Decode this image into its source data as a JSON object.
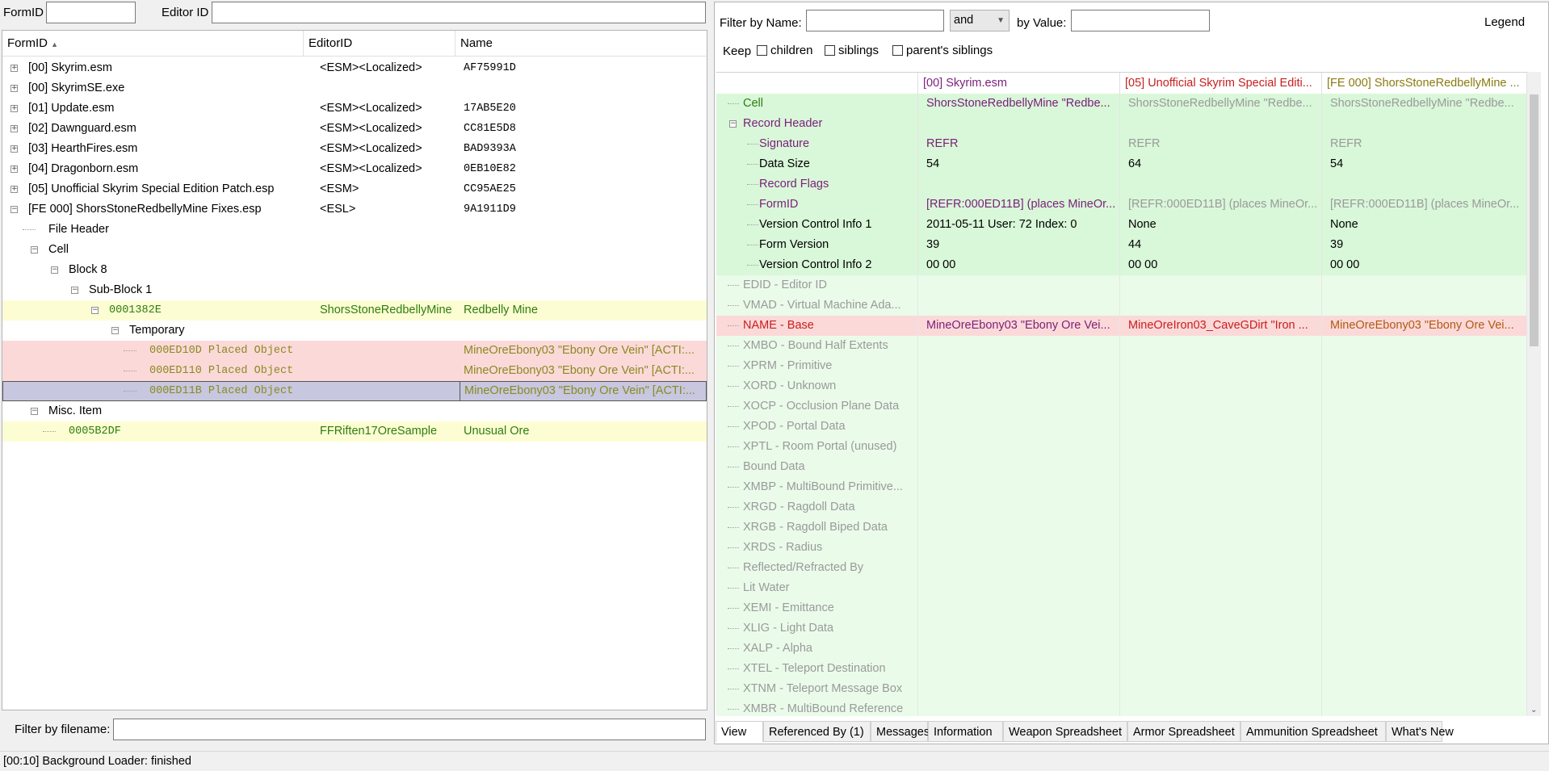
{
  "top": {
    "formid_label": "FormID",
    "editorid_label": "Editor ID",
    "formid_value": "",
    "editorid_value": ""
  },
  "tree": {
    "headers": [
      "FormID",
      "EditorID",
      "Name"
    ],
    "rows": [
      {
        "form": "[00] Skyrim.esm",
        "editor": "<ESM><Localized>",
        "name": "AF75991D"
      },
      {
        "form": "[00] SkyrimSE.exe",
        "editor": "",
        "name": ""
      },
      {
        "form": "[01] Update.esm",
        "editor": "<ESM><Localized>",
        "name": "17AB5E20"
      },
      {
        "form": "[02] Dawnguard.esm",
        "editor": "<ESM><Localized>",
        "name": "CC81E5D8"
      },
      {
        "form": "[03] HearthFires.esm",
        "editor": "<ESM><Localized>",
        "name": "BAD9393A"
      },
      {
        "form": "[04] Dragonborn.esm",
        "editor": "<ESM><Localized>",
        "name": "0EB10E82"
      },
      {
        "form": "[05] Unofficial Skyrim Special Edition Patch.esp",
        "editor": "<ESM>",
        "name": "CC95AE25"
      },
      {
        "form": "[FE 000] ShorsStoneRedbellyMine Fixes.esp",
        "editor": "<ESL>",
        "name": "9A1911D9"
      },
      {
        "form": "File Header",
        "editor": "",
        "name": ""
      },
      {
        "form": "Cell",
        "editor": "",
        "name": ""
      },
      {
        "form": "Block 8",
        "editor": "",
        "name": ""
      },
      {
        "form": "Sub-Block 1",
        "editor": "",
        "name": ""
      },
      {
        "form": "0001382E",
        "editor": "ShorsStoneRedbellyMine",
        "name": "Redbelly Mine"
      },
      {
        "form": "Temporary",
        "editor": "",
        "name": ""
      },
      {
        "form": "000ED10D  Placed Object",
        "editor": "",
        "name": "MineOreEbony03 \"Ebony Ore Vein\" [ACTI:..."
      },
      {
        "form": "000ED110  Placed Object",
        "editor": "",
        "name": "MineOreEbony03 \"Ebony Ore Vein\" [ACTI:..."
      },
      {
        "form": "000ED11B  Placed Object",
        "editor": "",
        "name": "MineOreEbony03 \"Ebony Ore Vein\" [ACTI:..."
      },
      {
        "form": "Misc. Item",
        "editor": "",
        "name": ""
      },
      {
        "form": "0005B2DF",
        "editor": "FFRiften17OreSample",
        "name": "Unusual Ore"
      }
    ]
  },
  "bottom_filter": {
    "label": "Filter by filename:",
    "value": ""
  },
  "right": {
    "filter_name_label": "Filter by Name:",
    "filter_name_value": "",
    "and_option": "and",
    "by_value_label": "by Value:",
    "by_value_value": "",
    "legend": "Legend",
    "keep_label": "Keep",
    "keep_children": "children",
    "keep_siblings": "siblings",
    "keep_parents": "parent's siblings"
  },
  "grid": {
    "headers": [
      "[00] Skyrim.esm",
      "[05] Unofficial Skyrim Special Editi...",
      "[FE 000] ShorsStoneRedbellyMine ..."
    ],
    "rows": [
      {
        "label": "Cell",
        "v": [
          "ShorsStoneRedbellyMine \"Redbe...",
          "ShorsStoneRedbellyMine \"Redbe...",
          "ShorsStoneRedbellyMine \"Redbe..."
        ]
      },
      {
        "label": "Record Header",
        "v": [
          "",
          "",
          ""
        ]
      },
      {
        "label": "Signature",
        "v": [
          "REFR",
          "REFR",
          "REFR"
        ]
      },
      {
        "label": "Data Size",
        "v": [
          "54",
          "64",
          "54"
        ]
      },
      {
        "label": "Record Flags",
        "v": [
          "",
          "",
          ""
        ]
      },
      {
        "label": "FormID",
        "v": [
          "[REFR:000ED11B] (places MineOr...",
          "[REFR:000ED11B] (places MineOr...",
          "[REFR:000ED11B] (places MineOr..."
        ]
      },
      {
        "label": "Version Control Info 1",
        "v": [
          "2011-05-11 User: 72 Index: 0",
          "None",
          "None"
        ]
      },
      {
        "label": "Form Version",
        "v": [
          "39",
          "44",
          "39"
        ]
      },
      {
        "label": "Version Control Info 2",
        "v": [
          "00 00",
          "00 00",
          "00 00"
        ]
      },
      {
        "label": "EDID - Editor ID",
        "v": [
          "",
          "",
          ""
        ]
      },
      {
        "label": "VMAD - Virtual Machine Ada...",
        "v": [
          "",
          "",
          ""
        ]
      },
      {
        "label": "NAME - Base",
        "v": [
          "MineOreEbony03 \"Ebony Ore Vei...",
          "MineOreIron03_CaveGDirt \"Iron ...",
          "MineOreEbony03 \"Ebony Ore Vei..."
        ]
      },
      {
        "label": "XMBO - Bound Half Extents",
        "v": [
          "",
          "",
          ""
        ]
      },
      {
        "label": "XPRM - Primitive",
        "v": [
          "",
          "",
          ""
        ]
      },
      {
        "label": "XORD - Unknown",
        "v": [
          "",
          "",
          ""
        ]
      },
      {
        "label": "XOCP - Occlusion Plane Data",
        "v": [
          "",
          "",
          ""
        ]
      },
      {
        "label": "XPOD - Portal Data",
        "v": [
          "",
          "",
          ""
        ]
      },
      {
        "label": "XPTL - Room Portal (unused)",
        "v": [
          "",
          "",
          ""
        ]
      },
      {
        "label": "Bound Data",
        "v": [
          "",
          "",
          ""
        ]
      },
      {
        "label": "XMBP - MultiBound Primitive...",
        "v": [
          "",
          "",
          ""
        ]
      },
      {
        "label": "XRGD - Ragdoll Data",
        "v": [
          "",
          "",
          ""
        ]
      },
      {
        "label": "XRGB - Ragdoll Biped Data",
        "v": [
          "",
          "",
          ""
        ]
      },
      {
        "label": "XRDS - Radius",
        "v": [
          "",
          "",
          ""
        ]
      },
      {
        "label": "Reflected/Refracted By",
        "v": [
          "",
          "",
          ""
        ]
      },
      {
        "label": "Lit Water",
        "v": [
          "",
          "",
          ""
        ]
      },
      {
        "label": "XEMI - Emittance",
        "v": [
          "",
          "",
          ""
        ]
      },
      {
        "label": "XLIG - Light Data",
        "v": [
          "",
          "",
          ""
        ]
      },
      {
        "label": "XALP - Alpha",
        "v": [
          "",
          "",
          ""
        ]
      },
      {
        "label": "XTEL - Teleport Destination",
        "v": [
          "",
          "",
          ""
        ]
      },
      {
        "label": "XTNM - Teleport Message Box",
        "v": [
          "",
          "",
          ""
        ]
      },
      {
        "label": "XMBR - MultiBound Reference",
        "v": [
          "",
          "",
          ""
        ]
      }
    ]
  },
  "tabs": [
    "View",
    "Referenced By (1)",
    "Messages",
    "Information",
    "Weapon Spreadsheet",
    "Armor Spreadsheet",
    "Ammunition Spreadsheet",
    "What's New"
  ],
  "status": "[00:10] Background Loader: finished",
  "colors": {
    "green_bg": "#d9f7d9",
    "light_green_bg": "#eafbea",
    "red_bg": "#fcd9d9",
    "yellow_bg": "#fdfdd3",
    "selected_bg": "#c7c7e0",
    "green_text": "#2e7d10",
    "purple_text": "#7a1f7a",
    "red_text": "#c81e1e",
    "gray_text": "#9a9a9a",
    "olive_text": "#8a8a20"
  }
}
